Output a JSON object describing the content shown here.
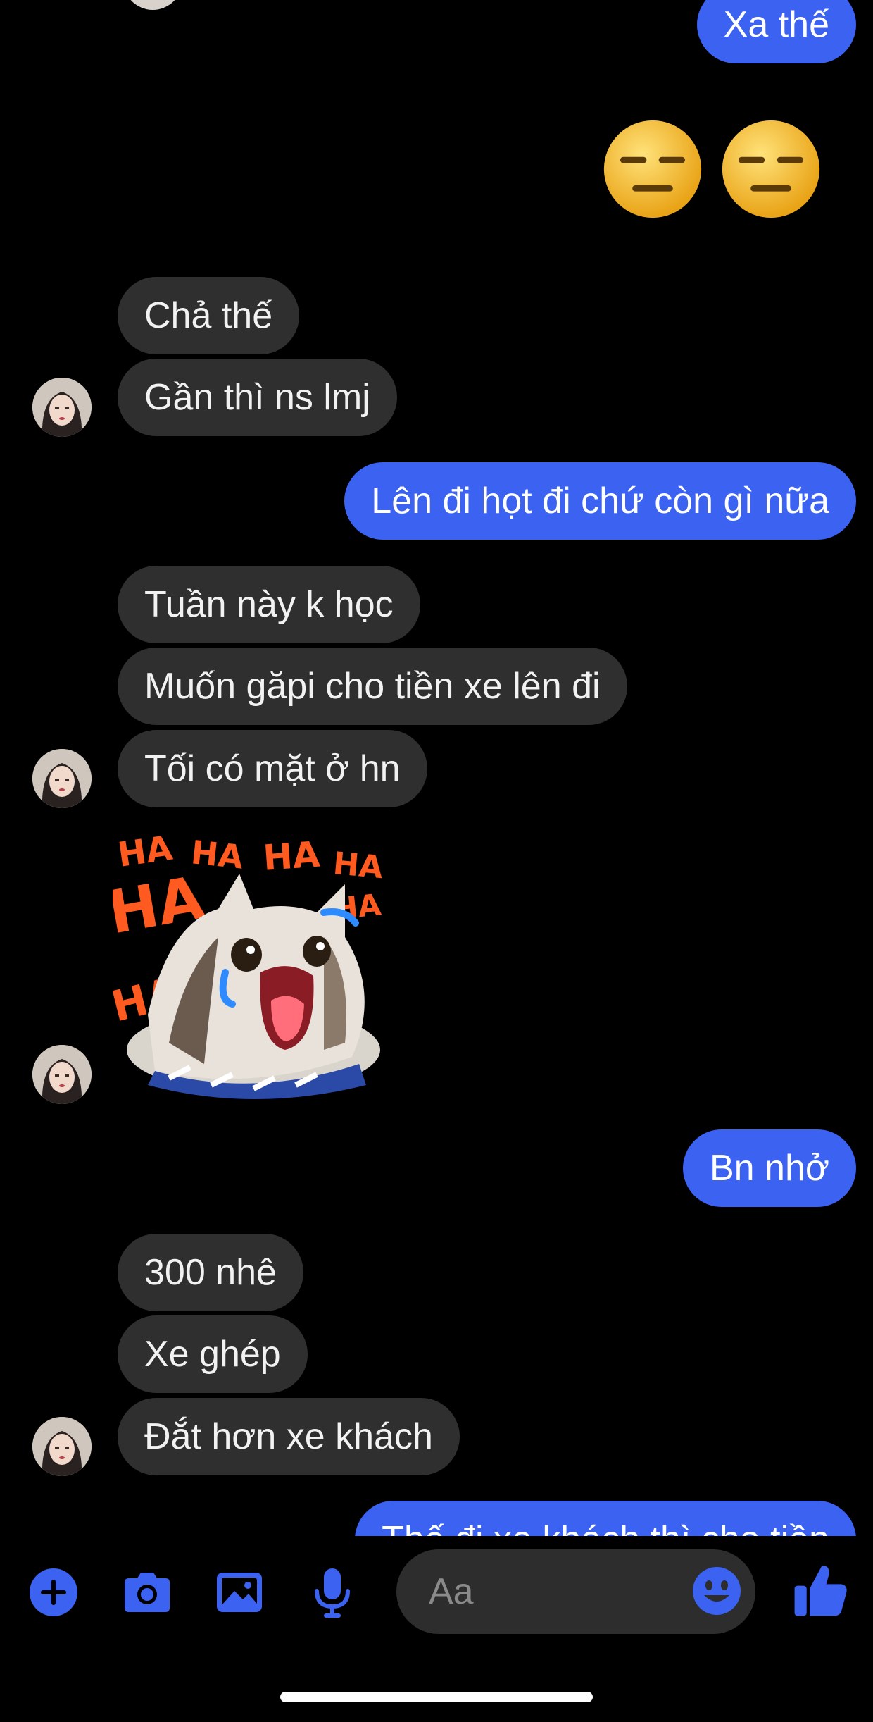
{
  "colors": {
    "background": "#000000",
    "incoming_bubble": "#2f2f2f",
    "outgoing_bubble": "#3b62f0",
    "accent": "#3b62f0"
  },
  "messages": {
    "m0": {
      "text": "Xa thế",
      "from": "me"
    },
    "m1": {
      "text": "Chả thế",
      "from": "them"
    },
    "m2": {
      "text": "Gần thì ns lmj",
      "from": "them"
    },
    "m3": {
      "text": "Lên đi họt đi chứ còn gì nữa",
      "from": "me"
    },
    "m4": {
      "text": "Tuần này k học",
      "from": "them"
    },
    "m5": {
      "text": "Muốn găpi cho tiền xe lên đi",
      "from": "them"
    },
    "m6": {
      "text": "Tối có mặt ở hn",
      "from": "them"
    },
    "m7": {
      "text": "Bn nhở",
      "from": "me"
    },
    "m8": {
      "text": "300 nhê",
      "from": "them"
    },
    "m9": {
      "text": "Xe ghép",
      "from": "them"
    },
    "m10": {
      "text": "Đắt hơn xe khách",
      "from": "them"
    },
    "m11": {
      "text": "Thế đi xe khách thì cho tiền",
      "from": "me"
    }
  },
  "emoji_reaction": {
    "emoji": "expressionless-face",
    "count": 2,
    "from": "me"
  },
  "sticker": {
    "name": "laughing-cat-sticker",
    "text": "HA HA HA HA HA HA HA"
  },
  "composer": {
    "placeholder": "Aa",
    "icons": [
      "plus-icon",
      "camera-icon",
      "image-icon",
      "microphone-icon",
      "emoji-icon",
      "thumbs-up-icon"
    ]
  }
}
